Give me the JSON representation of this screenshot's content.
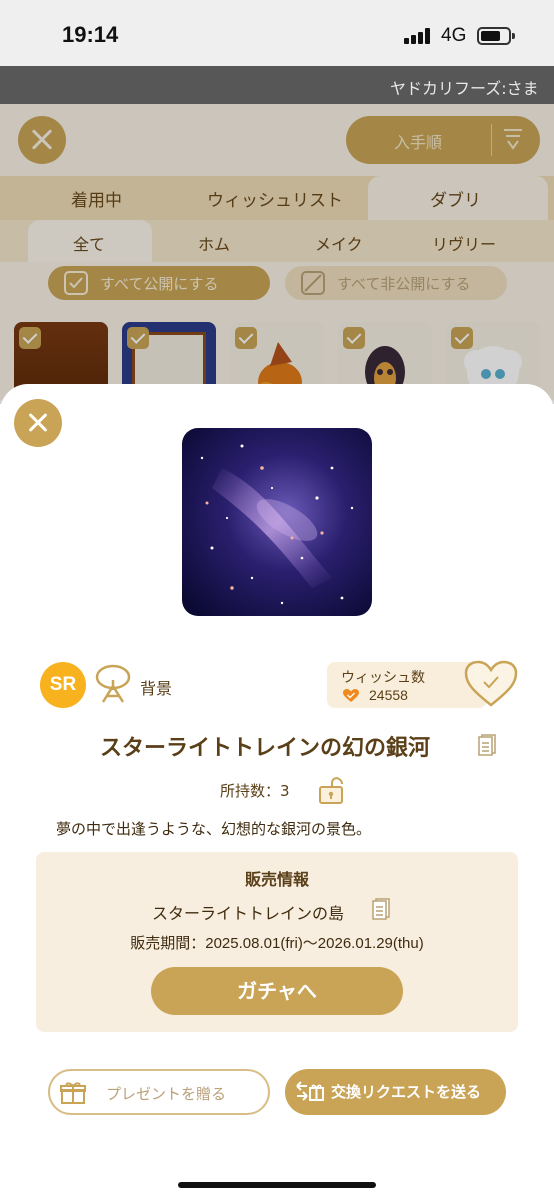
{
  "status_bar": {
    "time": "19:14",
    "network": "4G"
  },
  "ticker": {
    "text": "ヤドカリフーズ:さま"
  },
  "background": {
    "sort_label": "入手順",
    "tabs": [
      "着用中",
      "ウィッシュリスト",
      "ダブリ"
    ],
    "subtabs": [
      "全て",
      "ホム",
      "メイク",
      "リヴリー"
    ],
    "publish_all": "すべて公開にする",
    "unpublish_all": "すべて非公開にする"
  },
  "item": {
    "rarity": "SR",
    "category": "背景",
    "wish_title": "ウィッシュ数",
    "wish_count": "24558",
    "name": "スターライトトレインの幻の銀河",
    "owned": "所持数：3",
    "description": "夢の中で出逢うような、幻想的な銀河の景色。"
  },
  "sales": {
    "title": "販売情報",
    "island": "スターライトトレインの島",
    "period": "販売期間：2025.08.01(fri)〜2026.01.29(thu)",
    "gacha_button": "ガチャへ"
  },
  "actions": {
    "present": "プレゼントを贈る",
    "trade": "交換リクエストを送る"
  },
  "colors": {
    "accent_gold": "#c9a456",
    "rarity_yellow": "#f7b21e",
    "panel_cream": "#f8eedf",
    "text_brown": "#5a3f18"
  },
  "icons": [
    "signal-icon",
    "battery-icon",
    "close-icon",
    "sort-icon",
    "checkbox-icon",
    "category-icon",
    "heart-icon",
    "document-icon",
    "lock-icon",
    "gift-icon",
    "exchange-icon"
  ]
}
